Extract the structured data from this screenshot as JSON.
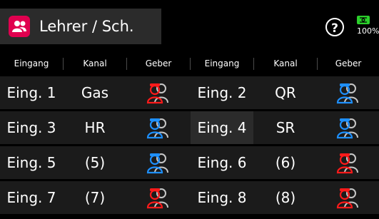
{
  "header": {
    "title": "Lehrer / Sch.",
    "battery_label": "100%",
    "colors": {
      "title_box": "#2b2b2b",
      "app_icon": "#e0004f",
      "battery": "#2bd02b"
    },
    "icons": {
      "app": "people-icon",
      "help": "question-icon",
      "battery": "battery-icon"
    }
  },
  "table": {
    "columns": [
      "Eingang",
      "Kanal",
      "Geber",
      "Eingang",
      "Kanal",
      "Geber"
    ],
    "rows": [
      {
        "left": {
          "input": "Eing. 1",
          "channel": "Gas",
          "giver": "red"
        },
        "right": {
          "input": "Eing. 2",
          "channel": "QR",
          "giver": "blue"
        }
      },
      {
        "left": {
          "input": "Eing. 3",
          "channel": "HR",
          "giver": "blue"
        },
        "right": {
          "input": "Eing. 4",
          "channel": "SR",
          "giver": "blue"
        }
      },
      {
        "left": {
          "input": "Eing. 5",
          "channel": "(5)",
          "giver": "blue"
        },
        "right": {
          "input": "Eing. 6",
          "channel": "(6)",
          "giver": "red"
        }
      },
      {
        "left": {
          "input": "Eing. 7",
          "channel": "(7)",
          "giver": "red"
        },
        "right": {
          "input": "Eing. 8",
          "channel": "(8)",
          "giver": "red"
        }
      }
    ],
    "giver_colors": {
      "red": "#ff1a1a",
      "blue": "#1e90ff"
    },
    "highlighted_cell": "row-2-right-input",
    "colors": {
      "row_bg": "#1b1b1b",
      "highlight_bg": "#2b2b2b",
      "separator": "#4b4b4b"
    }
  }
}
